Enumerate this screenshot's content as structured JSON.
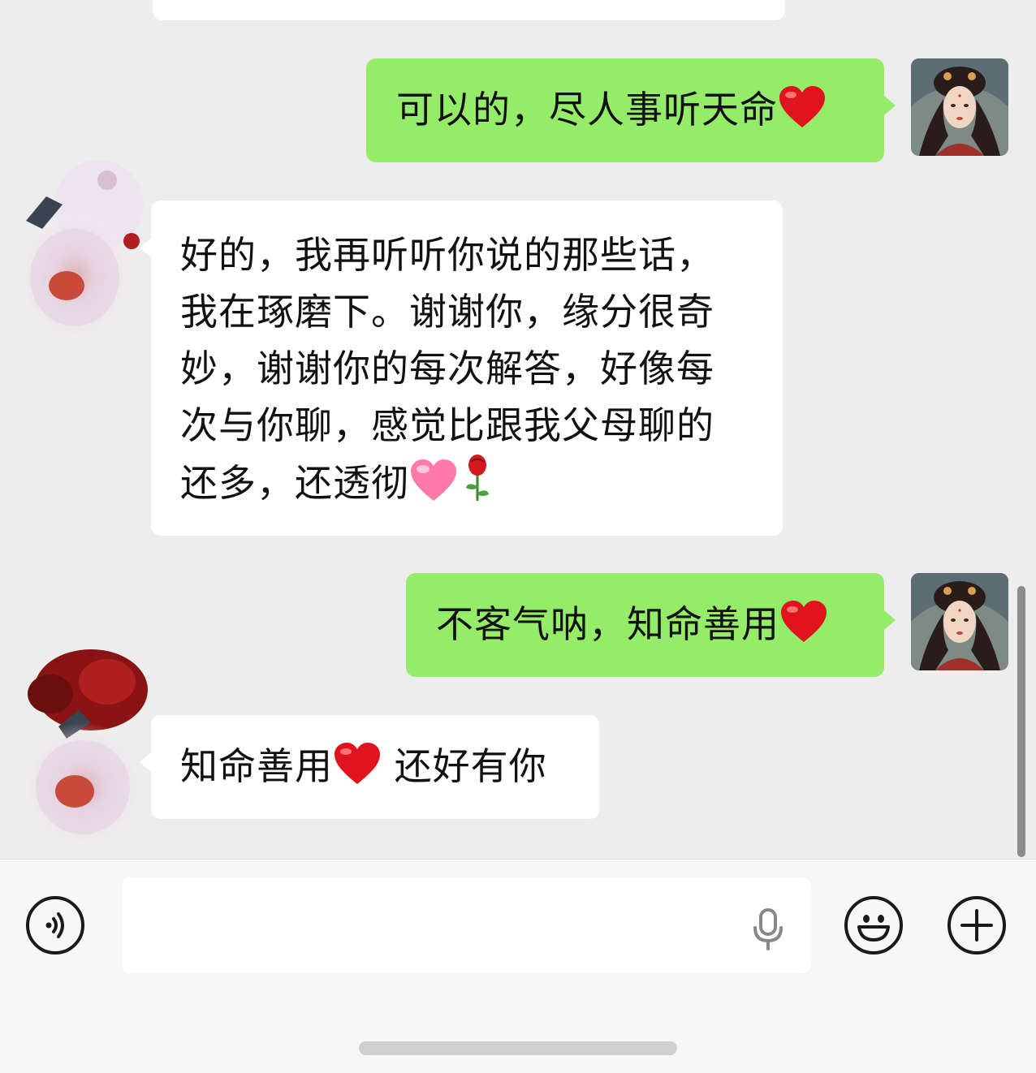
{
  "messages": [
    {
      "direction": "outgoing",
      "text": "可以的，尽人事听天命",
      "trailing_emoji": "heart-emoji"
    },
    {
      "direction": "incoming",
      "lines": [
        "好的，我再听听你说的那些话，",
        "我在琢磨下。谢谢你，缘分很奇",
        "妙，谢谢你的每次解答，好像每",
        "次与你聊，感觉比跟我父母聊的",
        "还多，还透彻"
      ],
      "trailing_emojis": [
        "pink-heart-emoji",
        "rose-emoji"
      ]
    },
    {
      "direction": "outgoing",
      "text": "不客气呐，知命善用",
      "trailing_emoji": "heart-emoji"
    },
    {
      "direction": "incoming",
      "text_before": "知命善用",
      "text_after": " 还好有你",
      "middle_emoji": "heart-emoji"
    }
  ],
  "input": {
    "placeholder": "",
    "value": ""
  },
  "icons": {
    "voice": "voice-mode-icon",
    "mic": "microphone-icon",
    "emoji": "emoji-smile-icon",
    "more": "plus-icon"
  },
  "colors": {
    "chat_background": "#ededed",
    "outgoing_bubble": "#95ec69",
    "incoming_bubble": "#ffffff"
  }
}
